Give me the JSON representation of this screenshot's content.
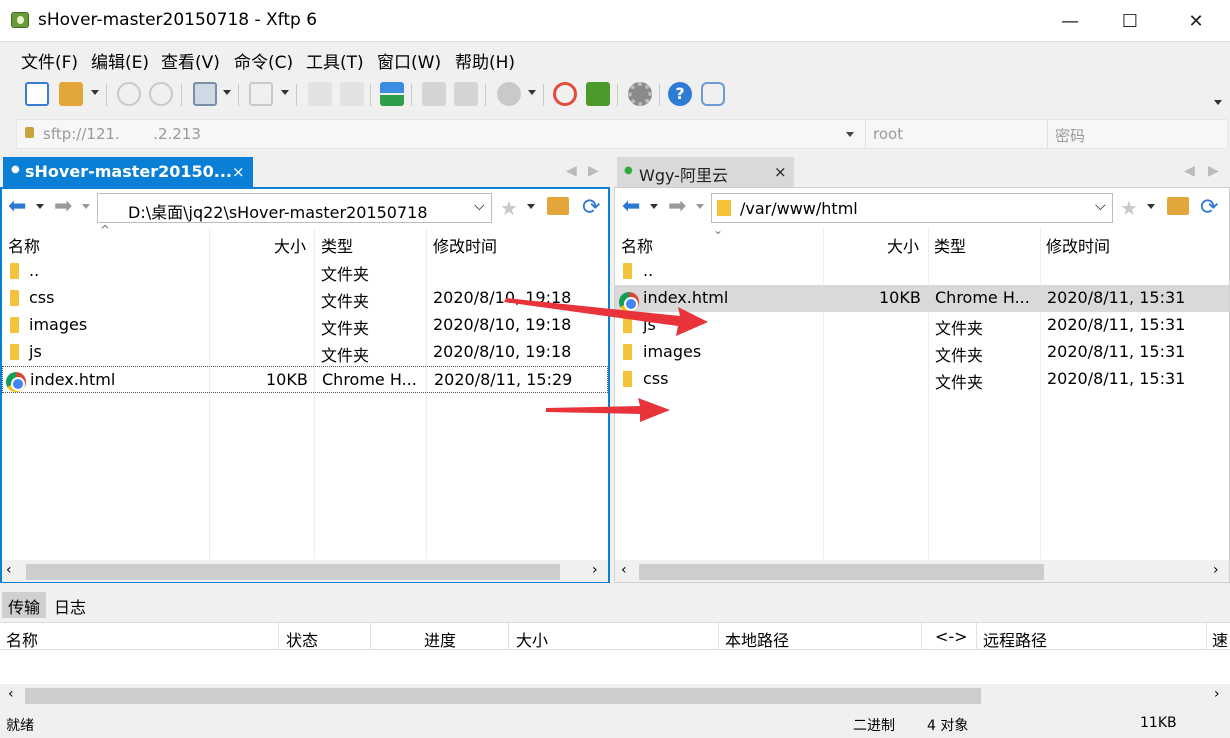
{
  "window": {
    "title": "sHover-master20150718 - Xftp 6",
    "min": "—",
    "max": "☐",
    "close": "✕"
  },
  "menu": [
    "文件(F)",
    "编辑(E)",
    "查看(V)",
    "命令(C)",
    "工具(T)",
    "窗口(W)",
    "帮助(H)"
  ],
  "address": {
    "host": "sftp://121.       .2.213",
    "user": "root",
    "password_placeholder": "密码"
  },
  "tabs": {
    "left": {
      "label": "sHover-master20150...",
      "close": "×",
      "dot": "●"
    },
    "right": {
      "label": "Wgy-阿里云",
      "close": "×",
      "dot": "●"
    }
  },
  "columns": {
    "name": "名称",
    "size": "大小",
    "type": "类型",
    "modified": "修改时间"
  },
  "left": {
    "path": "D:\\桌面\\jq22\\sHover-master20150718",
    "rows": [
      {
        "name": "..",
        "size": "",
        "type": "文件夹",
        "modified": "",
        "kind": "folder"
      },
      {
        "name": "css",
        "size": "",
        "type": "文件夹",
        "modified": "2020/8/10, 19:18",
        "kind": "folder"
      },
      {
        "name": "images",
        "size": "",
        "type": "文件夹",
        "modified": "2020/8/10, 19:18",
        "kind": "folder"
      },
      {
        "name": "js",
        "size": "",
        "type": "文件夹",
        "modified": "2020/8/10, 19:18",
        "kind": "folder"
      },
      {
        "name": "index.html",
        "size": "10KB",
        "type": "Chrome H...",
        "modified": "2020/8/11, 15:29",
        "kind": "html"
      }
    ]
  },
  "right": {
    "path": "/var/www/html",
    "rows": [
      {
        "name": "..",
        "size": "",
        "type": "",
        "modified": "",
        "kind": "folder"
      },
      {
        "name": "index.html",
        "size": "10KB",
        "type": "Chrome H...",
        "modified": "2020/8/11, 15:31",
        "kind": "html"
      },
      {
        "name": "js",
        "size": "",
        "type": "文件夹",
        "modified": "2020/8/11, 15:31",
        "kind": "folder"
      },
      {
        "name": "images",
        "size": "",
        "type": "文件夹",
        "modified": "2020/8/11, 15:31",
        "kind": "folder"
      },
      {
        "name": "css",
        "size": "",
        "type": "文件夹",
        "modified": "2020/8/11, 15:31",
        "kind": "folder"
      }
    ]
  },
  "bottom": {
    "tabs": [
      "传输",
      "日志"
    ],
    "columns": [
      "名称",
      "状态",
      "进度",
      "大小",
      "本地路径",
      "<->",
      "远程路径",
      "速"
    ]
  },
  "status": {
    "ready": "就绪",
    "mode": "二进制",
    "objects": "4 对象",
    "size": "11KB"
  },
  "colors": {
    "accent": "#0a7fd6",
    "arrow": "#e8333a",
    "folder": "#f5c33b"
  }
}
